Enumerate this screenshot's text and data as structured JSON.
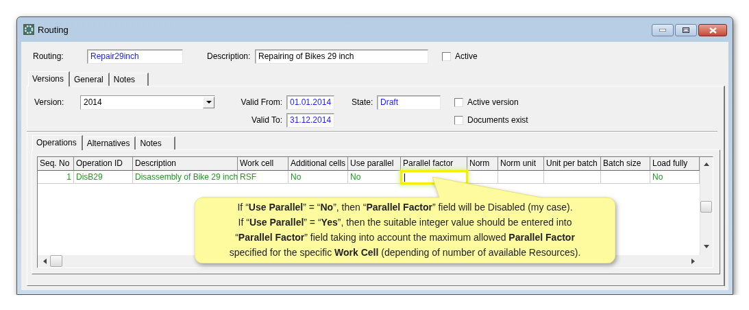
{
  "window": {
    "title": "Routing"
  },
  "header": {
    "routing_label": "Routing:",
    "routing_value": "Repair29inch",
    "description_label": "Description:",
    "description_value": "Repairing of Bikes 29 inch",
    "active": {
      "label": "Active",
      "checked": false
    }
  },
  "tabs": [
    {
      "label": "Versions",
      "selected": true
    },
    {
      "label": "General",
      "selected": false
    },
    {
      "label": "Notes",
      "selected": false
    }
  ],
  "version": {
    "version_label": "Version:",
    "version_value": "2014",
    "valid_from_label": "Valid From:",
    "valid_from": "01.01.2014",
    "valid_to_label": "Valid To:",
    "valid_to": "31.12.2014",
    "state_label": "State:",
    "state": "Draft",
    "checks": [
      {
        "label": "Active version",
        "checked": false
      },
      {
        "label": "Documents exist",
        "checked": false
      }
    ]
  },
  "inner_tabs": [
    {
      "label": "Operations",
      "selected": true
    },
    {
      "label": "Alternatives",
      "selected": false
    },
    {
      "label": "Notes",
      "selected": false
    }
  ],
  "table": {
    "columns": [
      "Seq. No",
      "Operation ID",
      "Description",
      "Work cell",
      "Additional cells",
      "Use parallel",
      "Parallel factor",
      "Norm",
      "Norm unit",
      "Unit per batch",
      "Batch size",
      "Load fully"
    ],
    "rows": [
      {
        "cells": [
          {
            "text": "1",
            "highlighted": false
          },
          {
            "text": "DisB29",
            "highlighted": false
          },
          {
            "text": "Disassembly of Bike 29 inch",
            "highlighted": false
          },
          {
            "text": "RSF",
            "highlighted": false
          },
          {
            "text": "No",
            "highlighted": false
          },
          {
            "text": "No",
            "highlighted": false
          },
          {
            "highlighted": true
          },
          {
            "highlighted": false
          },
          {
            "highlighted": false
          },
          {
            "highlighted": false
          },
          {
            "highlighted": false
          },
          {
            "text": "No",
            "highlighted": false
          }
        ]
      }
    ]
  },
  "callout": {
    "lines": [
      "If “**Use Parallel**” = “**No**”, then “**Parallel Factor**” field will be Disabled (my case).",
      "If “**Use Parallel**” = “**Yes**”, then the suitable integer value should be entered into",
      "“**Parallel Factor**” field taking into account the maximum allowed **Parallel Factor**",
      "specified for the specific **Work Cell** (depending of number of available Resources)."
    ]
  }
}
